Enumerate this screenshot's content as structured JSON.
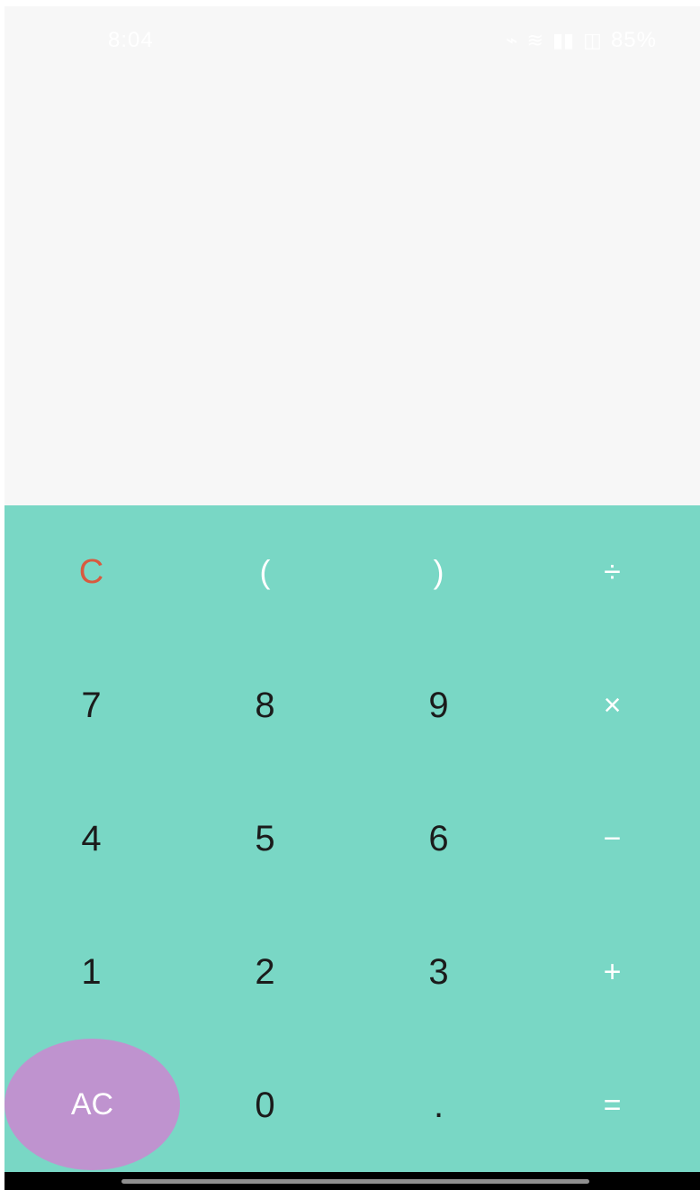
{
  "status_bar": {
    "time": "8:04",
    "battery": "85%",
    "icons": [
      "bluetooth-muted-icon",
      "vibrate-icon",
      "wifi-signal-icon",
      "cellular-signal-icon"
    ]
  },
  "display": {
    "expression": "",
    "result": ""
  },
  "keypad": {
    "rows": [
      [
        "C",
        "(",
        ")",
        "÷"
      ],
      [
        "7",
        "8",
        "9",
        "×"
      ],
      [
        "4",
        "5",
        "6",
        "−"
      ],
      [
        "1",
        "2",
        "3",
        "+"
      ],
      [
        "AC",
        "0",
        ".",
        "="
      ]
    ]
  },
  "colors": {
    "keypad_background": "#79d7c5",
    "clear_key": "#d85a3f",
    "ac_button": "#bf93cf",
    "operator_text": "#ffffff",
    "digit_text": "#1b1b1b"
  }
}
